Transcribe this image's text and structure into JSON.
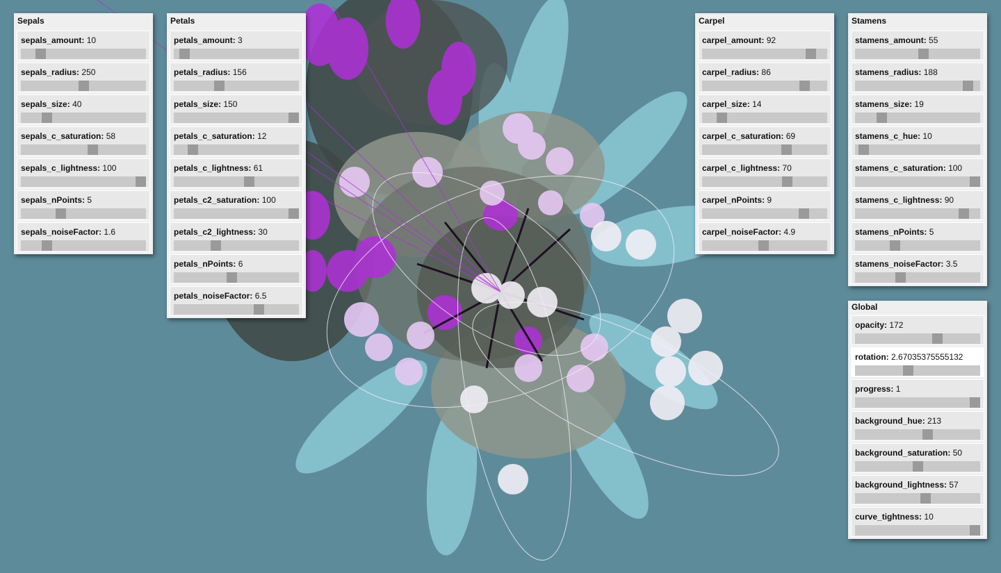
{
  "panels": [
    {
      "key": "sepals",
      "title": "Sepals",
      "rows": [
        {
          "name": "sepals_amount",
          "value": "10",
          "fraction": 0.13
        },
        {
          "name": "sepals_radius",
          "value": "250",
          "fraction": 0.5
        },
        {
          "name": "sepals_size",
          "value": "40",
          "fraction": 0.18
        },
        {
          "name": "sepals_c_saturation",
          "value": "58",
          "fraction": 0.58
        },
        {
          "name": "sepals_c_lightness",
          "value": "100",
          "fraction": 1.0
        },
        {
          "name": "sepals_nPoints",
          "value": "5",
          "fraction": 0.3
        },
        {
          "name": "sepals_noiseFactor",
          "value": "1.6",
          "fraction": 0.18
        }
      ]
    },
    {
      "key": "petals",
      "title": "Petals",
      "rows": [
        {
          "name": "petals_amount",
          "value": "3",
          "fraction": 0.05
        },
        {
          "name": "petals_radius",
          "value": "156",
          "fraction": 0.35
        },
        {
          "name": "petals_size",
          "value": "150",
          "fraction": 1.0
        },
        {
          "name": "petals_c_saturation",
          "value": "12",
          "fraction": 0.12
        },
        {
          "name": "petals_c_lightness",
          "value": "61",
          "fraction": 0.61
        },
        {
          "name": "petals_c2_saturation",
          "value": "100",
          "fraction": 1.0
        },
        {
          "name": "petals_c2_lightness",
          "value": "30",
          "fraction": 0.32
        },
        {
          "name": "petals_nPoints",
          "value": "6",
          "fraction": 0.46
        },
        {
          "name": "petals_noiseFactor",
          "value": "6.5",
          "fraction": 0.7
        }
      ]
    },
    {
      "key": "carpel",
      "title": "Carpel",
      "rows": [
        {
          "name": "carpel_amount",
          "value": "92",
          "fraction": 0.9
        },
        {
          "name": "carpel_radius",
          "value": "86",
          "fraction": 0.85
        },
        {
          "name": "carpel_size",
          "value": "14",
          "fraction": 0.13
        },
        {
          "name": "carpel_c_saturation",
          "value": "69",
          "fraction": 0.69
        },
        {
          "name": "carpel_c_lightness",
          "value": "70",
          "fraction": 0.7
        },
        {
          "name": "carpel_nPoints",
          "value": "9",
          "fraction": 0.84
        },
        {
          "name": "carpel_noiseFactor",
          "value": "4.9",
          "fraction": 0.49
        }
      ]
    },
    {
      "key": "stamens",
      "title": "Stamens",
      "rows": [
        {
          "name": "stamens_amount",
          "value": "55",
          "fraction": 0.55
        },
        {
          "name": "stamens_radius",
          "value": "188",
          "fraction": 0.94
        },
        {
          "name": "stamens_size",
          "value": "19",
          "fraction": 0.19
        },
        {
          "name": "stamens_c_hue",
          "value": "10",
          "fraction": 0.03
        },
        {
          "name": "stamens_c_saturation",
          "value": "100",
          "fraction": 1.0
        },
        {
          "name": "stamens_c_lightness",
          "value": "90",
          "fraction": 0.9
        },
        {
          "name": "stamens_nPoints",
          "value": "5",
          "fraction": 0.3
        },
        {
          "name": "stamens_noiseFactor",
          "value": "3.5",
          "fraction": 0.35
        }
      ]
    },
    {
      "key": "global",
      "title": "Global",
      "rows": [
        {
          "name": "opacity",
          "value": "172",
          "fraction": 0.67
        },
        {
          "name": "rotation",
          "value": "2.67035375555132",
          "fraction": 0.42,
          "active": true
        },
        {
          "name": "progress",
          "value": "1",
          "fraction": 1.0
        },
        {
          "name": "background_hue",
          "value": "213",
          "fraction": 0.59
        },
        {
          "name": "background_saturation",
          "value": "50",
          "fraction": 0.5
        },
        {
          "name": "background_lightness",
          "value": "57",
          "fraction": 0.57
        },
        {
          "name": "curve_tightness",
          "value": "10",
          "fraction": 1.0
        }
      ]
    }
  ],
  "colors": {
    "background": "#5e8b99",
    "sepal": "#8cc9d6",
    "petal_gray": "#8f958c",
    "petal_dark": "#5a5f58",
    "magenta": "#b12fd9",
    "lavender": "#e6c8f2",
    "white_stamen": "#f1eef5"
  }
}
